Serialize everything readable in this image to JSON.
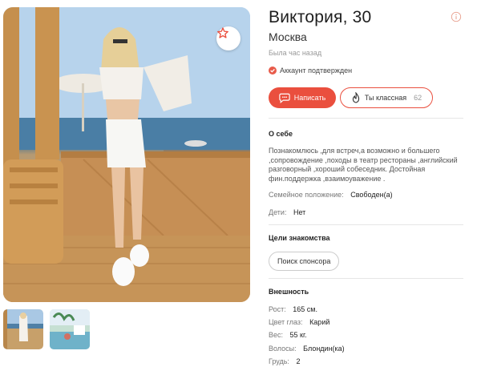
{
  "profile": {
    "name_age": "Виктория, 30",
    "city": "Москва",
    "last_seen": "Была час назад",
    "verified": "Аккаунт подтвержден"
  },
  "actions": {
    "write_label": "Написать",
    "like_label": "Ты классная",
    "like_count": "62"
  },
  "about": {
    "title": "О себе",
    "text": "Познакомлюсь ,для встреч,а возможно и большего ,сопровождение ,походы в театр рестораны ,английский разговорный ,хороший собеседник. Достойная фин.поддержка ,взаимоуважение .",
    "marital_label": "Семейное положение:",
    "marital_value": "Свободен(а)",
    "kids_label": "Дети:",
    "kids_value": "Нет"
  },
  "goals": {
    "title": "Цели знакомства",
    "chip": "Поиск спонсора"
  },
  "appearance": {
    "title": "Внешность",
    "height_label": "Рост:",
    "height_value": "165 см.",
    "eyes_label": "Цвет глаз:",
    "eyes_value": "Карий",
    "weight_label": "Вес:",
    "weight_value": "55 кг.",
    "hair_label": "Волосы:",
    "hair_value": "Блондин(ка)",
    "breast_label": "Грудь:",
    "breast_value": "2"
  },
  "colors": {
    "accent": "#ea4f3e"
  },
  "icons": {
    "favorite": "star-icon",
    "info": "info-icon",
    "verified": "check-icon",
    "write": "chat-icon",
    "like": "flame-icon"
  }
}
